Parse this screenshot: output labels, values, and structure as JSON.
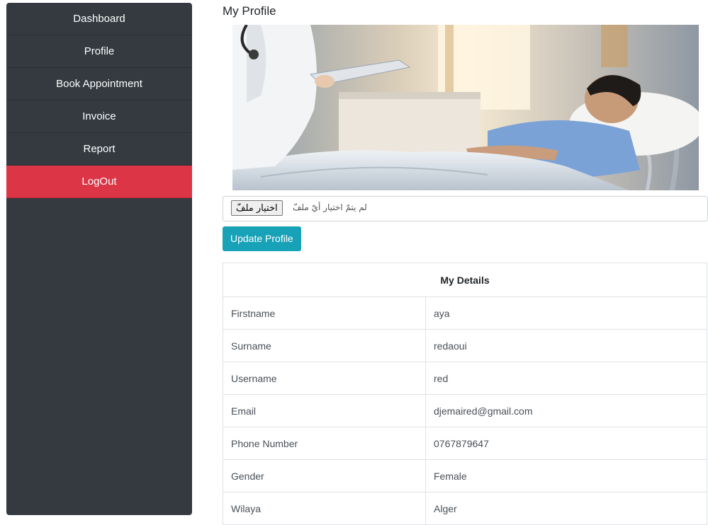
{
  "sidebar": {
    "items": [
      {
        "label": "Dashboard"
      },
      {
        "label": "Profile"
      },
      {
        "label": "Book Appointment"
      },
      {
        "label": "Invoice"
      },
      {
        "label": "Report"
      },
      {
        "label": "LogOut"
      }
    ],
    "colors": {
      "background": "#343a40",
      "logout": "#dc3545"
    }
  },
  "main": {
    "title": "My Profile",
    "hero_image": "hospital-room-doctor-patient-photo",
    "file_input": {
      "button_label": "اختيار ملفّ",
      "status": "لم يتمّ اختيار أيّ ملفّ"
    },
    "update_button": "Update Profile",
    "update_button_color": "#17a2b8",
    "details": {
      "heading": "My Details",
      "rows": [
        {
          "label": "Firstname",
          "value": "aya"
        },
        {
          "label": "Surname",
          "value": "redaoui"
        },
        {
          "label": "Username",
          "value": "red"
        },
        {
          "label": "Email",
          "value": "djemaired@gmail.com"
        },
        {
          "label": "Phone Number",
          "value": "0767879647"
        },
        {
          "label": "Gender",
          "value": "Female"
        },
        {
          "label": "Wilaya",
          "value": "Alger"
        }
      ]
    }
  }
}
